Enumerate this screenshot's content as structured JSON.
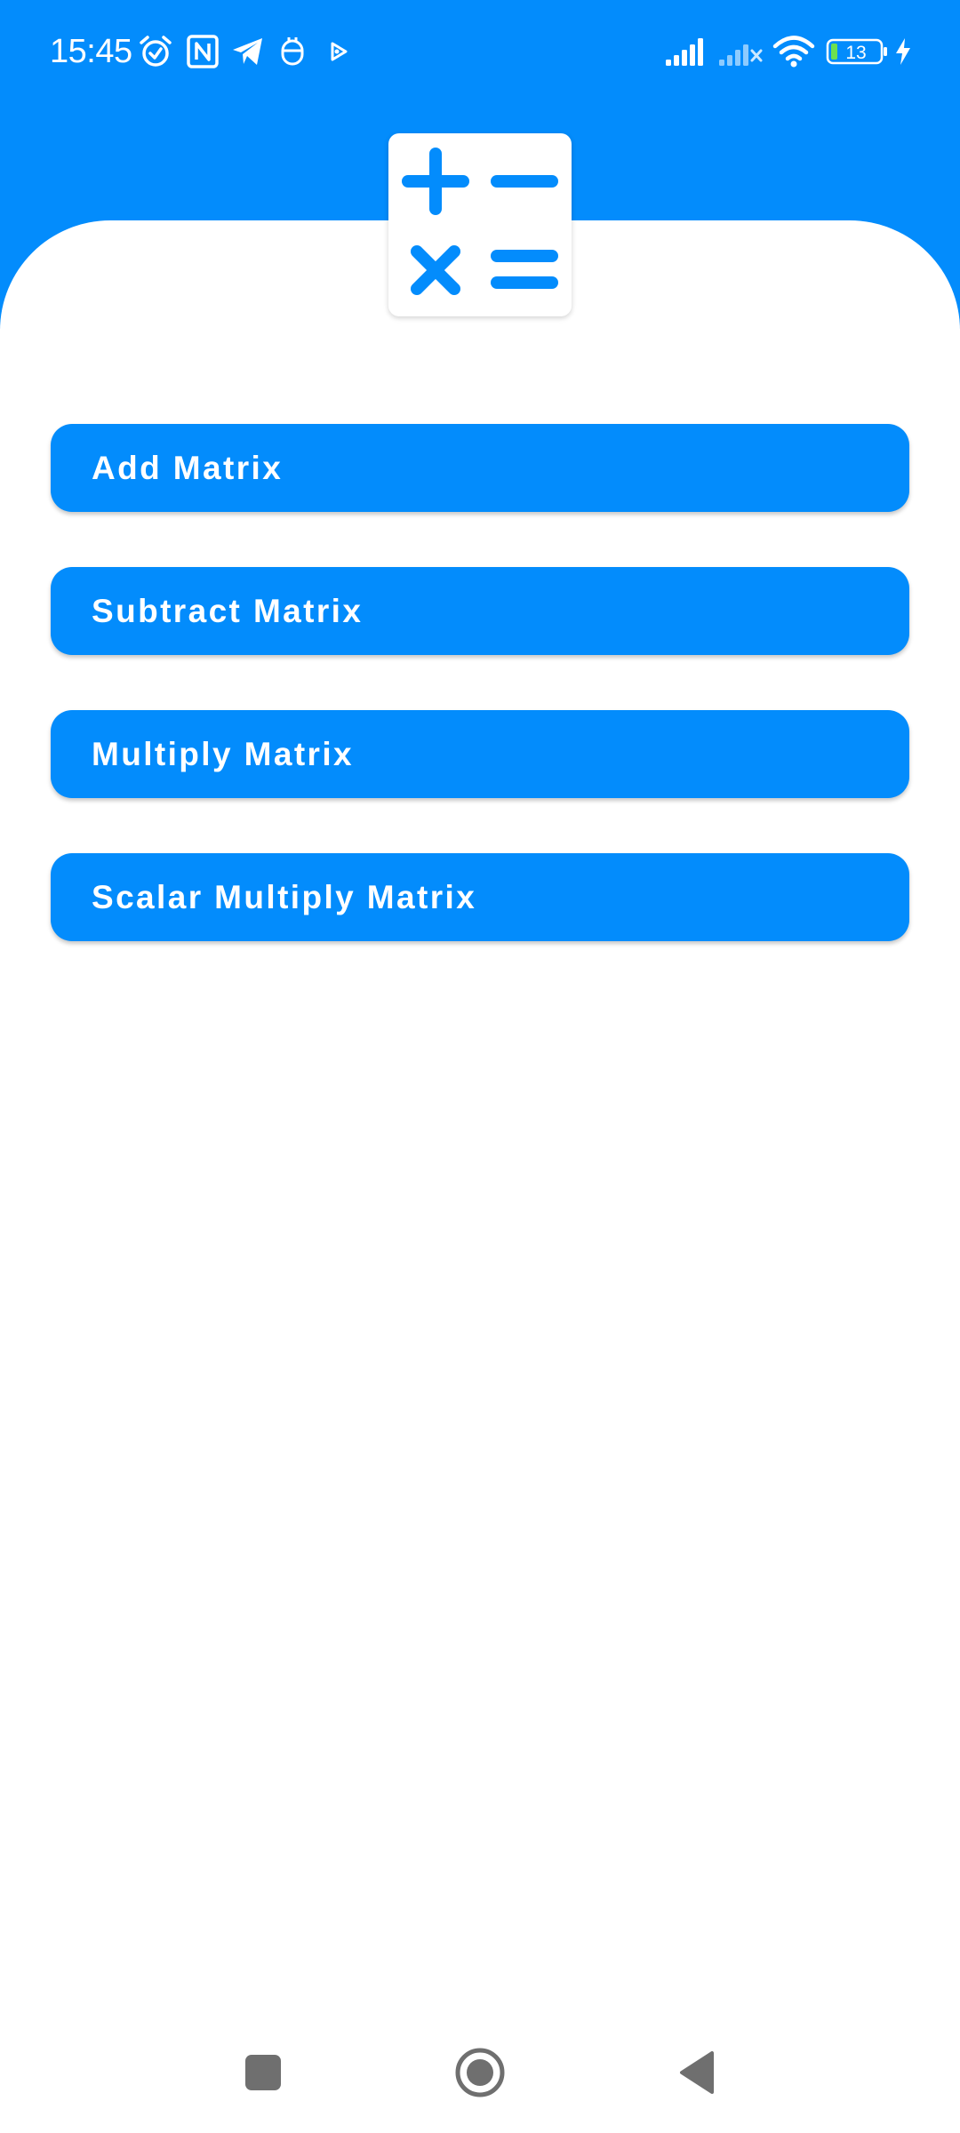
{
  "status_bar": {
    "time": "15:45",
    "battery_level": "13",
    "icons": [
      "alarm-icon",
      "nfc-icon",
      "telegram-icon",
      "vpn-icon",
      "play-icon",
      "signal-icon",
      "signal-no-service-icon",
      "wifi-icon",
      "battery-icon",
      "charging-icon"
    ]
  },
  "header": {
    "logo_icon": "calculator-operators-icon"
  },
  "operations": [
    {
      "label": "Add Matrix"
    },
    {
      "label": "Subtract Matrix"
    },
    {
      "label": "Multiply Matrix"
    },
    {
      "label": "Scalar Multiply Matrix"
    }
  ],
  "nav_bar": {
    "icons": [
      "recents-square-icon",
      "home-circle-icon",
      "back-triangle-icon"
    ]
  },
  "colors": {
    "primary": "#038cfc",
    "background": "#ffffff",
    "nav_icon": "#6f6f6f"
  }
}
